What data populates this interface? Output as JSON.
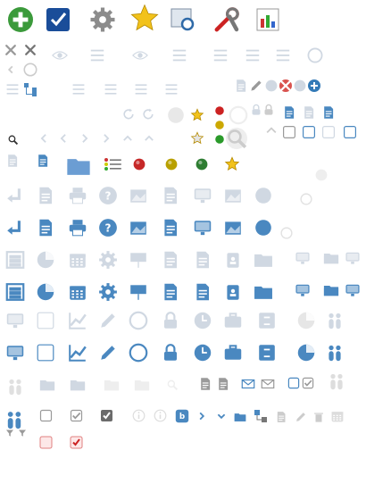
{
  "sprite": {
    "colors": {
      "blue": "#4a88c0",
      "faded": "#d0d8e2",
      "gray": "#9a9a9a",
      "light_gray": "#cccccc",
      "green": "#3b9a3b",
      "gold": "#f2c21b",
      "red": "#cc2a2a",
      "folder_blue": "#6c9dd3"
    },
    "rows": [
      {
        "name": "top-toolbar",
        "icons": [
          "add-icon",
          "checklist-icon",
          "settings-gear-icon",
          "star-icon",
          "window-search-icon",
          "tools-icon",
          "report-chart-icon"
        ]
      },
      {
        "name": "small-controls",
        "icons": [
          "close-icon",
          "close-dark-icon",
          "eye-icon",
          "search-list-icon",
          "list-icon",
          "tools-list-icon",
          "clock-icon",
          "refresh-icon",
          "edit-icon",
          "remove-icon",
          "add-small-icon"
        ]
      },
      {
        "name": "large-blue",
        "icons": [
          "return-icon",
          "document-edit-icon",
          "printer-icon",
          "help-icon",
          "picture-icon",
          "notepad-icon",
          "window-settings-icon",
          "map-icon",
          "location-icon"
        ]
      },
      {
        "name": "large-blue-2",
        "icons": [
          "abacus-icon",
          "pie-chart-icon",
          "calendar-icon",
          "gears-icon",
          "presentation-icon",
          "document-copy-icon",
          "notebook-icon",
          "badge-icon",
          "folder-c-icon",
          "screen-icon"
        ]
      },
      {
        "name": "large-blue-3",
        "icons": [
          "id-card-icon",
          "pencil-edit-icon",
          "line-chart-icon",
          "pencil-icon",
          "close-circle-icon",
          "lock-icon",
          "clock-icon",
          "briefcase-icon",
          "cabinet-icon",
          "pie-chart-icon",
          "people-icon"
        ]
      },
      {
        "name": "small-form-controls",
        "icons": [
          "team-icon",
          "checkbox-icon",
          "checkbox-checked-icon",
          "info-icon",
          "beta-icon",
          "chevron-right-icon",
          "chevron-down-icon",
          "folder-icon",
          "hierarchy-icon",
          "comment-icon",
          "pencil-icon",
          "trash-icon",
          "calendar-icon",
          "filter-icon"
        ]
      }
    ]
  }
}
